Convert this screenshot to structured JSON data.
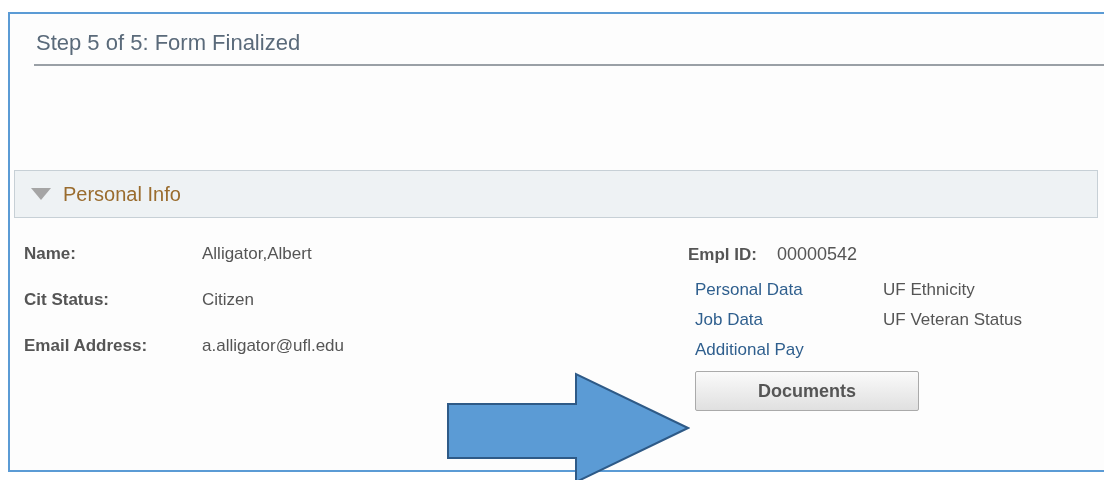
{
  "page_title": "Step 5 of 5: Form Finalized",
  "section": {
    "title": "Personal Info",
    "expanded": true
  },
  "left_fields": [
    {
      "label": "Name:",
      "value": "Alligator,Albert"
    },
    {
      "label": "Cit Status:",
      "value": "Citizen"
    },
    {
      "label": "Email Address:",
      "value": "a.alligator@ufl.edu"
    }
  ],
  "empl_id": {
    "label": "Empl ID:",
    "value": "00000542"
  },
  "links": [
    "Personal Data",
    "Job Data",
    "Additional Pay"
  ],
  "info_items": [
    "UF Ethnicity",
    "UF Veteran Status"
  ],
  "button": "Documents",
  "annotation": {
    "kind": "arrow"
  }
}
